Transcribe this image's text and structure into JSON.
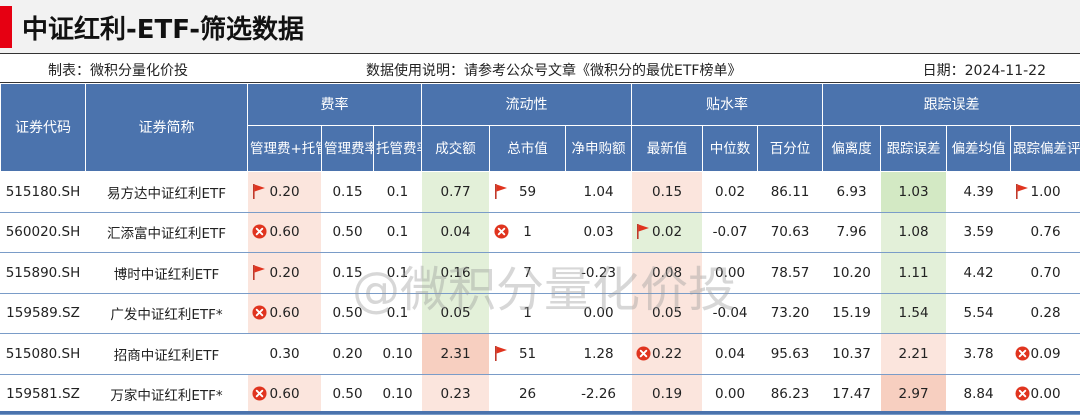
{
  "title": "中证红利-ETF-筛选数据",
  "meta": {
    "maker": "制表：微积分量化价投",
    "usage": "数据使用说明：请参考公众号文章《微积分的最优ETF榜单》",
    "date": "日期：2024-11-22"
  },
  "header": {
    "code": "证券代码",
    "name": "证券简称",
    "groups": [
      "费率",
      "流动性",
      "贴水率",
      "跟踪误差"
    ],
    "columns": [
      "管理费+托管费",
      "管理费率",
      "托管费率",
      "成交额",
      "总市值",
      "净申购额",
      "最新值",
      "中位数",
      "百分位",
      "偏离度",
      "跟踪误差",
      "偏差均值",
      "跟踪偏差评分"
    ]
  },
  "rows": [
    {
      "code": "515180.SH",
      "name": "易方达中证红利ETF",
      "cells": [
        "0.20",
        "0.15",
        "0.1",
        "0.77",
        "59",
        "1.04",
        "0.15",
        "0.02",
        "86.11",
        "6.93",
        "1.03",
        "4.39",
        "1.00"
      ]
    },
    {
      "code": "560020.SH",
      "name": "汇添富中证红利ETF",
      "cells": [
        "0.60",
        "0.50",
        "0.1",
        "0.04",
        "1",
        "0.03",
        "0.02",
        "-0.07",
        "70.63",
        "7.96",
        "1.08",
        "3.59",
        "0.76"
      ]
    },
    {
      "code": "515890.SH",
      "name": "博时中证红利ETF",
      "cells": [
        "0.20",
        "0.15",
        "0.1",
        "0.16",
        "7",
        "-0.23",
        "0.08",
        "0.00",
        "78.57",
        "10.20",
        "1.11",
        "4.42",
        "0.70"
      ]
    },
    {
      "code": "159589.SZ",
      "name": "广发中证红利ETF*",
      "cells": [
        "0.60",
        "0.50",
        "0.1",
        "0.05",
        "1",
        "0.00",
        "0.05",
        "-0.04",
        "73.20",
        "15.19",
        "1.54",
        "5.54",
        "0.28"
      ]
    },
    {
      "code": "515080.SH",
      "name": "招商中证红利ETF",
      "cells": [
        "0.30",
        "0.20",
        "0.10",
        "2.31",
        "51",
        "1.28",
        "0.22",
        "0.04",
        "95.63",
        "10.37",
        "2.21",
        "3.78",
        "0.09"
      ]
    },
    {
      "code": "159581.SZ",
      "name": "万家中证红利ETF*",
      "cells": [
        "0.60",
        "0.50",
        "0.10",
        "0.23",
        "26",
        "-2.26",
        "0.19",
        "0.00",
        "86.23",
        "17.47",
        "2.97",
        "8.84",
        "0.00"
      ]
    }
  ],
  "watermark": "@微积分量化价投",
  "colors": {
    "header_blue": "#4b73ad",
    "accent_red": "#e60012",
    "flag_red": "#e0341f",
    "green_fill": "#e3f0d9",
    "pink_fill": "#fbe5dd"
  }
}
